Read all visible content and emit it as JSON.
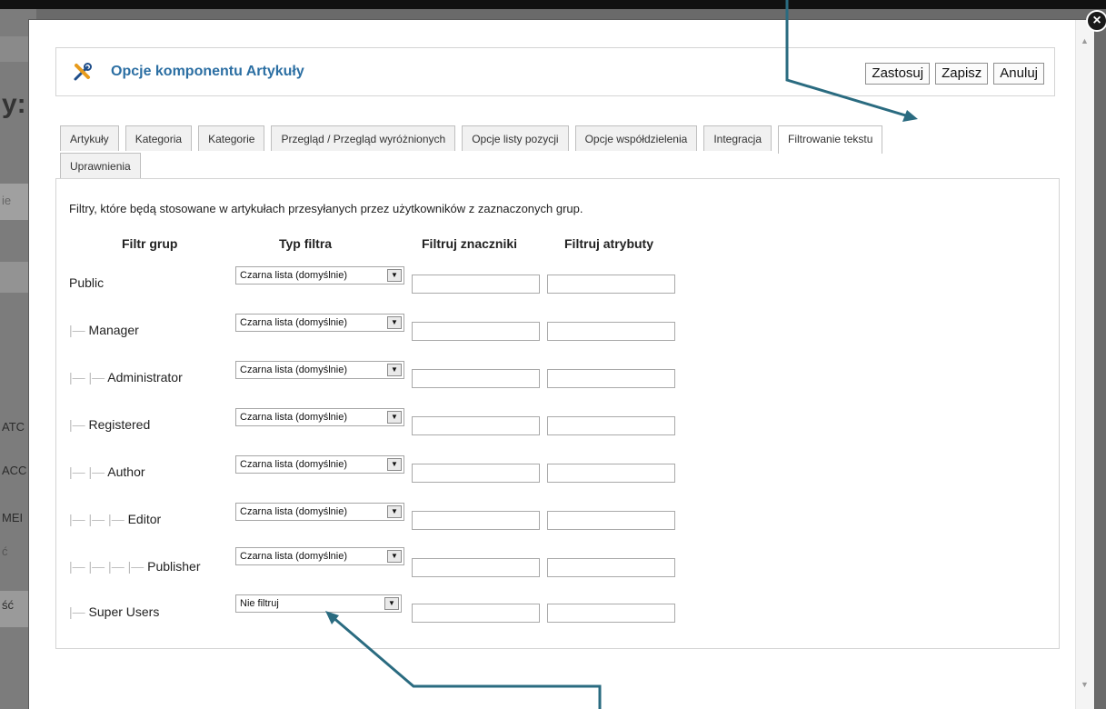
{
  "background": {
    "fragments": [
      "y:",
      "ie",
      "ATC",
      "ACC",
      "MEI",
      "ć",
      "ść"
    ]
  },
  "header": {
    "title": "Opcje komponentu Artykuły",
    "buttons": {
      "apply": "Zastosuj",
      "save": "Zapisz",
      "cancel": "Anuluj"
    }
  },
  "tabs": [
    "Artykuły",
    "Kategoria",
    "Kategorie",
    "Przegląd / Przegląd wyróżnionych",
    "Opcje listy pozycji",
    "Opcje współdzielenia",
    "Integracja",
    "Filtrowanie tekstu",
    "Uprawnienia"
  ],
  "active_tab": "Filtrowanie tekstu",
  "filters": {
    "description": "Filtry, które będą stosowane w artykułach przesyłanych przez użytkowników z zaznaczonych grup.",
    "columns": {
      "group": "Filtr grup",
      "type": "Typ filtra",
      "tags": "Filtruj znaczniki",
      "attributes": "Filtruj atrybuty"
    },
    "rows": [
      {
        "name": "Public",
        "filter_type": "Czarna lista (domyślnie)",
        "tags": "",
        "attributes": ""
      },
      {
        "name": "Manager",
        "filter_type": "Czarna lista (domyślnie)",
        "tags": "",
        "attributes": ""
      },
      {
        "name": "Administrator",
        "filter_type": "Czarna lista (domyślnie)",
        "tags": "",
        "attributes": ""
      },
      {
        "name": "Registered",
        "filter_type": "Czarna lista (domyślnie)",
        "tags": "",
        "attributes": ""
      },
      {
        "name": "Author",
        "filter_type": "Czarna lista (domyślnie)",
        "tags": "",
        "attributes": ""
      },
      {
        "name": "Editor",
        "filter_type": "Czarna lista (domyślnie)",
        "tags": "",
        "attributes": ""
      },
      {
        "name": "Publisher",
        "filter_type": "Czarna lista (domyślnie)",
        "tags": "",
        "attributes": ""
      },
      {
        "name": "Super Users",
        "filter_type": "Nie filtruj",
        "tags": "",
        "attributes": ""
      }
    ],
    "tree_prefix": [
      "",
      "|— ",
      "|— |— ",
      "|— ",
      "|— |— ",
      "|— |— |— ",
      "|— |— |— |— ",
      "|— "
    ]
  },
  "colors": {
    "title": "#2c6fa3",
    "arrow": "#2a6b80"
  },
  "icons": {
    "header": "tools-icon",
    "close": "close-icon",
    "select_arrow": "chevron-down-icon"
  }
}
